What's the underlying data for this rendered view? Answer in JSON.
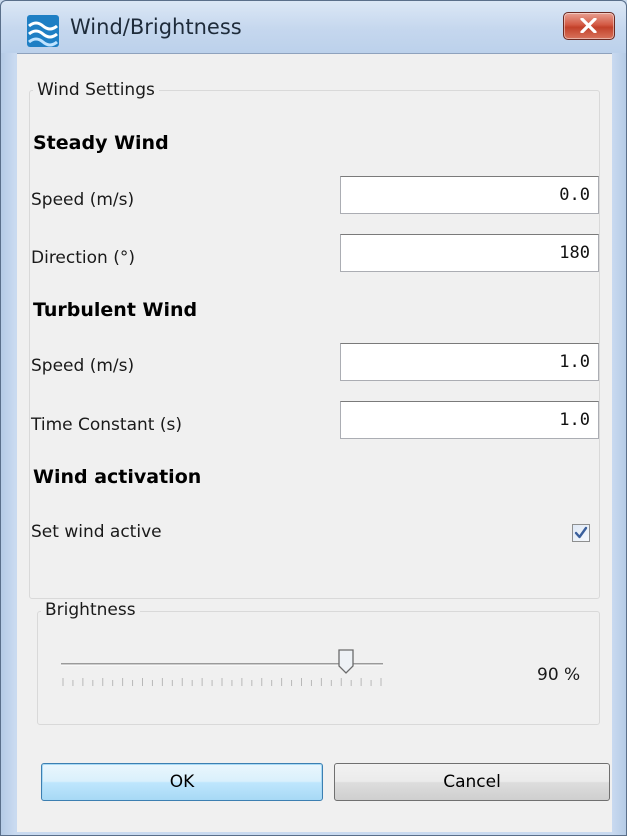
{
  "window": {
    "title": "Wind/Brightness",
    "icon": "wind-waves-icon",
    "close_icon": "close-x-icon",
    "accent_color": "#c9d9ec",
    "close_color": "#c7452e"
  },
  "wind_settings": {
    "group_title": "Wind Settings",
    "steady": {
      "heading": "Steady Wind",
      "speed_label": "Speed (m/s)",
      "speed_value": "0.0",
      "direction_label": "Direction (°)",
      "direction_value": "180"
    },
    "turbulent": {
      "heading": "Turbulent Wind",
      "speed_label": "Speed (m/s)",
      "speed_value": "1.0",
      "time_constant_label": "Time Constant (s)",
      "time_constant_value": "1.0"
    },
    "activation": {
      "heading": "Wind activation",
      "active_label": "Set wind active",
      "active_checked": true
    }
  },
  "brightness": {
    "group_title": "Brightness",
    "value": 0.9,
    "value_text": "90 %"
  },
  "buttons": {
    "ok_label": "OK",
    "cancel_label": "Cancel"
  }
}
